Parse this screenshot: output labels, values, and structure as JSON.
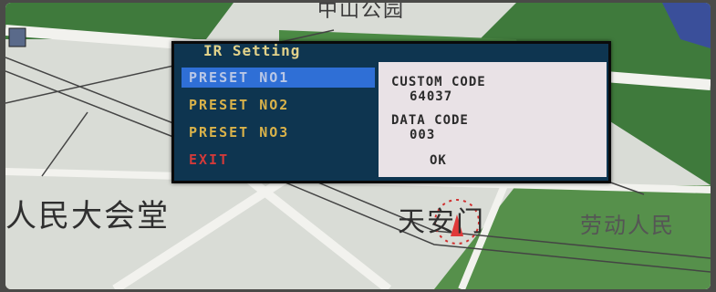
{
  "map": {
    "labels": {
      "hall": "人民大会堂",
      "gate": "天安门",
      "labor": "劳动人民",
      "top": "中山公园"
    },
    "colors": {
      "green": "#3f7a3c",
      "road": "#f2f2ee",
      "ground": "#d9dcd6"
    }
  },
  "osd": {
    "title": "IR Setting",
    "menu": [
      {
        "label": "PRESET NO1",
        "selected": true
      },
      {
        "label": "PRESET NO2",
        "selected": false
      },
      {
        "label": "PRESET NO3",
        "selected": false
      },
      {
        "label": "EXIT",
        "selected": false
      }
    ],
    "panel": {
      "custom_code_label": "CUSTOM CODE",
      "custom_code_value": "64037",
      "data_code_label": "DATA CODE",
      "data_code_value": "003",
      "ok_label": "OK"
    },
    "colors": {
      "background": "#0e3550",
      "highlight": "#2f6fd6",
      "item_text": "#d9b24a",
      "exit_text": "#d23a3a",
      "panel": "#e9e2e6"
    }
  }
}
